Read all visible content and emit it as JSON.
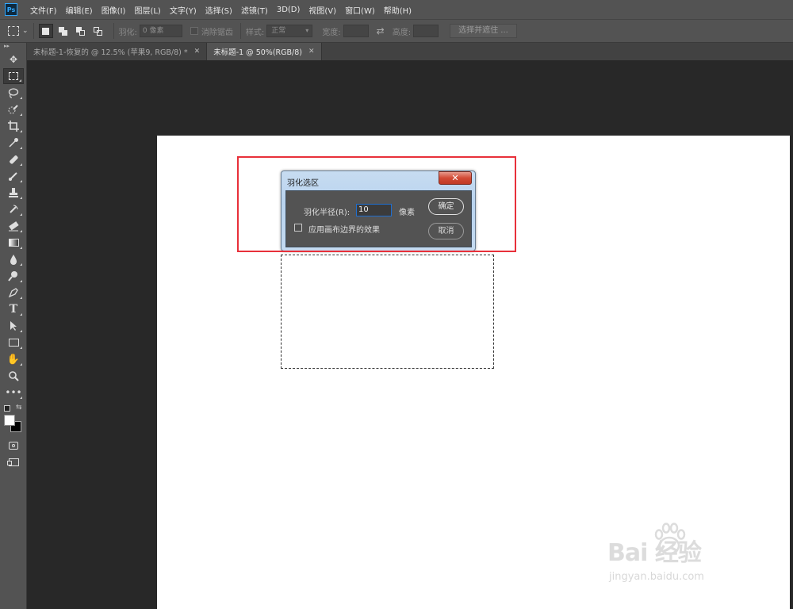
{
  "app": {
    "logo": "Ps"
  },
  "menu": [
    "文件(F)",
    "编辑(E)",
    "图像(I)",
    "图层(L)",
    "文字(Y)",
    "选择(S)",
    "滤镜(T)",
    "3D(D)",
    "视图(V)",
    "窗口(W)",
    "帮助(H)"
  ],
  "options": {
    "feather_label": "羽化:",
    "feather_value": "0 像素",
    "antialias_label": "消除锯齿",
    "style_label": "样式:",
    "style_value": "正常",
    "width_label": "宽度:",
    "height_label": "高度:",
    "select_mask_button": "选择并遮住 ..."
  },
  "tabs": [
    {
      "label": "未标题-1-恢复的 @ 12.5% (苹果9, RGB/8) *",
      "active": false
    },
    {
      "label": "未标题-1 @ 50%(RGB/8)",
      "active": true
    }
  ],
  "tools": [
    "move-tool",
    "rectangular-marquee-tool",
    "lasso-tool",
    "quick-selection-tool",
    "crop-tool",
    "eyedropper-tool",
    "healing-brush-tool",
    "brush-tool",
    "clone-stamp-tool",
    "history-brush-tool",
    "eraser-tool",
    "gradient-tool",
    "blur-tool",
    "dodge-tool",
    "pen-tool",
    "type-tool",
    "path-selection-tool",
    "rectangle-tool",
    "hand-tool",
    "zoom-tool",
    "more-tools"
  ],
  "colors": {
    "foreground": "#ffffff",
    "background": "#000000",
    "highlight": "#e8303a"
  },
  "dialog": {
    "title": "羽化选区",
    "close": "✕",
    "radius_label": "羽化半径(R):",
    "radius_value": "10",
    "radius_unit": "像素",
    "edge_checkbox_label": "应用画布边界的效果",
    "edge_checked": false,
    "ok_button": "确定",
    "cancel_button": "取消"
  },
  "watermark": {
    "brand": "Bai  经验",
    "url": "jingyan.baidu.com"
  }
}
